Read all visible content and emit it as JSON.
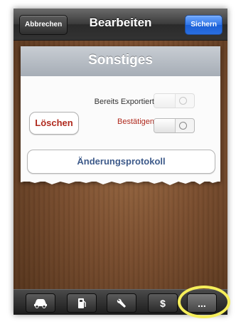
{
  "navbar": {
    "cancel_label": "Abbrechen",
    "title": "Bearbeiten",
    "save_label": "Sichern"
  },
  "card": {
    "title": "Sonstiges",
    "exported_label": "Bereits Exportiert",
    "exported_on": false,
    "exported_enabled": false,
    "confirm_label": "Bestätigen",
    "confirm_on": false,
    "delete_label": "Löschen",
    "protocol_label": "Änderungsprotokoll"
  },
  "tabbar": {
    "tabs": [
      {
        "icon": "car-icon",
        "label": ""
      },
      {
        "icon": "fuel-pump-icon",
        "label": ""
      },
      {
        "icon": "wrench-icon",
        "label": ""
      },
      {
        "icon": "dollar-icon",
        "label": "$"
      },
      {
        "icon": "more-icon",
        "label": "..."
      }
    ],
    "active_index": 4
  },
  "colors": {
    "save_button": "#2f74e6",
    "delete_text": "#b02a1e",
    "confirm_text": "#b02a1e",
    "protocol_text": "#3d5a8a",
    "highlight_ring": "#f5ee5a"
  }
}
